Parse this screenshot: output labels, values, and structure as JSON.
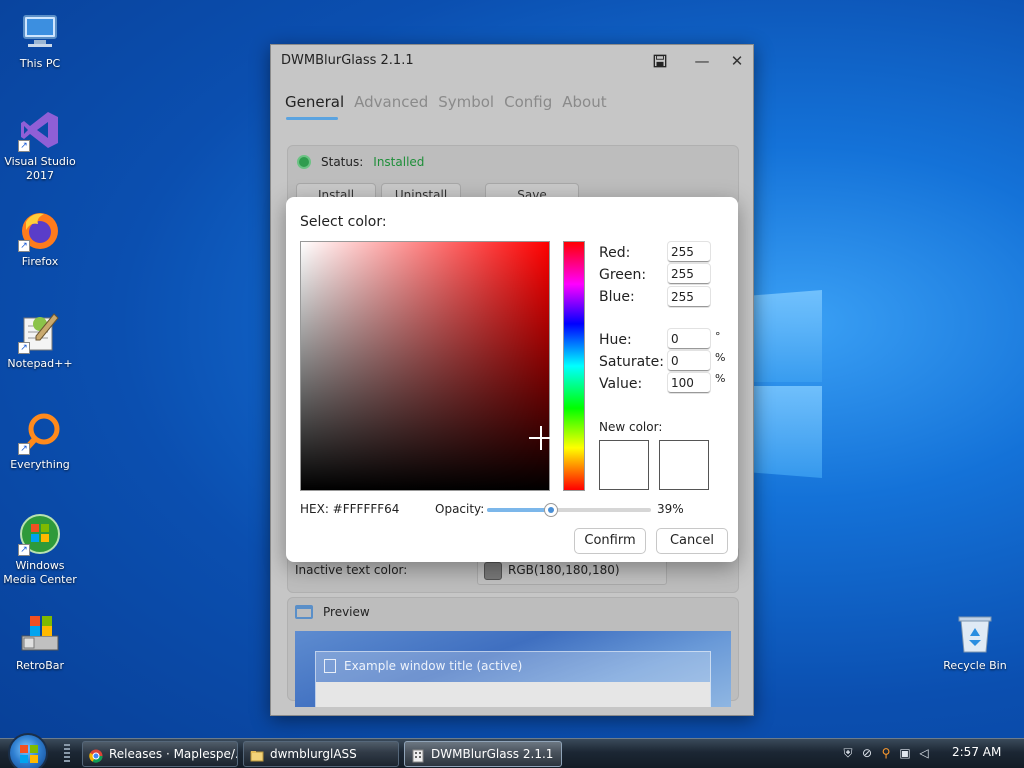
{
  "desktop": {
    "icons": [
      {
        "label": "This PC"
      },
      {
        "label": "Visual Studio 2017"
      },
      {
        "label": "Firefox"
      },
      {
        "label": "Notepad++"
      },
      {
        "label": "Everything"
      },
      {
        "label": "Windows Media Center"
      },
      {
        "label": "RetroBar"
      },
      {
        "label": "Recycle Bin"
      }
    ]
  },
  "window": {
    "title": "DWMBlurGlass 2.1.1",
    "controls": {
      "save_icon": "save-icon",
      "minimize_glyph": "—",
      "close_glyph": "✕"
    },
    "tabs": [
      {
        "label": "General",
        "active": true
      },
      {
        "label": "Advanced"
      },
      {
        "label": "Symbol"
      },
      {
        "label": "Config"
      },
      {
        "label": "About"
      }
    ],
    "status": {
      "label": "Status:",
      "value": "Installed"
    },
    "buttons": {
      "install": "Install",
      "uninstall": "Uninstall",
      "save": "Save"
    },
    "inactive_text_color": {
      "label": "Inactive text color:",
      "value": "RGB(180,180,180)"
    },
    "preview": {
      "label": "Preview",
      "window_title": "Example window title (active)"
    }
  },
  "color_dialog": {
    "title": "Select color:",
    "rgb": {
      "red_label": "Red:",
      "red": "255",
      "green_label": "Green:",
      "green": "255",
      "blue_label": "Blue:",
      "blue": "255"
    },
    "hsv": {
      "hue_label": "Hue:",
      "hue": "0",
      "hue_unit": "°",
      "saturate_label": "Saturate:",
      "saturate": "0",
      "saturate_unit": "%",
      "value_label": "Value:",
      "value": "100",
      "value_unit": "%"
    },
    "new_color_label": "New color:",
    "new_color": "#FFFFFF",
    "old_color": "#FFFFFF",
    "hex": "HEX: #FFFFFF64",
    "opacity_label": "Opacity:",
    "opacity": 0.39,
    "opacity_text": "39%",
    "confirm": "Confirm",
    "cancel": "Cancel"
  },
  "taskbar": {
    "tasks": [
      {
        "label": "Releases · Maplespe/..."
      },
      {
        "label": "dwmblurglASS"
      },
      {
        "label": "DWMBlurGlass 2.1.1",
        "active": true
      }
    ],
    "clock": "2:57 AM"
  }
}
